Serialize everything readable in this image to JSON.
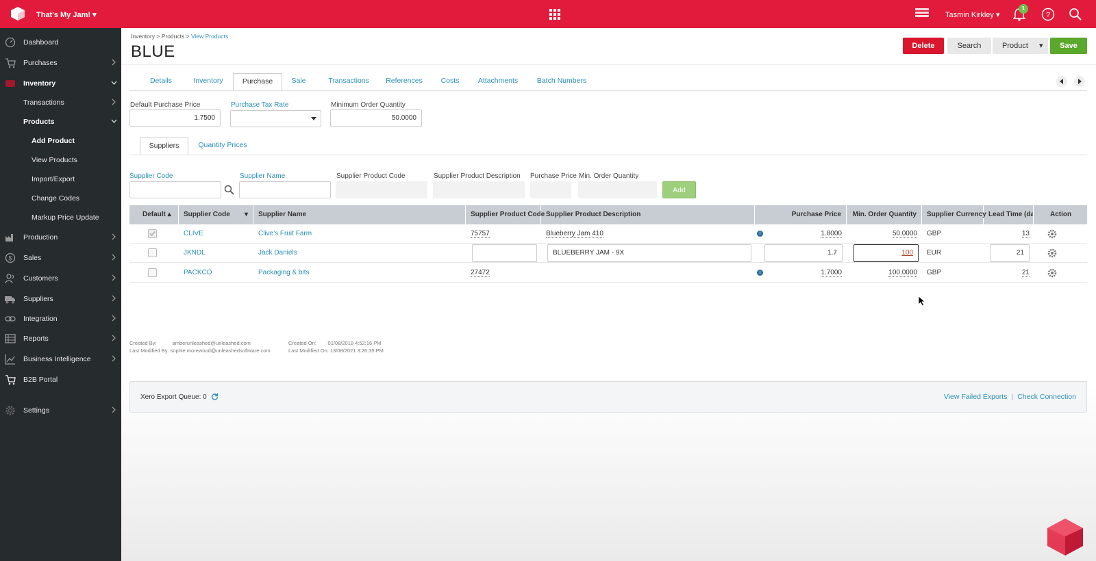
{
  "topbar": {
    "org_name": "That's My Jam!",
    "user_name": "Tasmin Kirkley",
    "notification_count": "1",
    "brand_color": "#e21b3c"
  },
  "sidebar": {
    "items": [
      {
        "label": "Dashboard",
        "icon": "dashboard-icon"
      },
      {
        "label": "Purchases",
        "icon": "cart-icon"
      },
      {
        "label": "Inventory",
        "icon": "inventory-icon"
      },
      {
        "label": "Transactions"
      },
      {
        "label": "Products"
      },
      {
        "label": "Add Product"
      },
      {
        "label": "View Products"
      },
      {
        "label": "Import/Export"
      },
      {
        "label": "Change Codes"
      },
      {
        "label": "Markup Price Update"
      },
      {
        "label": "Production",
        "icon": "factory-icon"
      },
      {
        "label": "Sales",
        "icon": "dollar-icon"
      },
      {
        "label": "Customers",
        "icon": "customers-icon"
      },
      {
        "label": "Suppliers",
        "icon": "truck-icon"
      },
      {
        "label": "Integration",
        "icon": "link-icon"
      },
      {
        "label": "Reports",
        "icon": "reports-icon"
      },
      {
        "label": "Business Intelligence",
        "icon": "chart-icon"
      },
      {
        "label": "B2B Portal",
        "icon": "cart-icon"
      },
      {
        "label": "Settings",
        "icon": "gear-icon"
      }
    ]
  },
  "breadcrumb": {
    "part1": "Inventory",
    "sep": ">",
    "part2": "Products",
    "link": "View Products"
  },
  "page_title": "BLUE",
  "actions": {
    "delete": "Delete",
    "search": "Search",
    "product": "Product",
    "save": "Save"
  },
  "tabs": [
    "Details",
    "Inventory",
    "Purchase",
    "Sale",
    "Transactions",
    "References",
    "Costs",
    "Attachments",
    "Batch Numbers"
  ],
  "active_tab": "Purchase",
  "purchase": {
    "default_price_label": "Default Purchase Price",
    "default_price": "1.7500",
    "tax_rate_label": "Purchase Tax Rate",
    "tax_rate": "",
    "min_order_label": "Minimum Order Quantity",
    "min_order": "50.0000"
  },
  "subtabs": [
    "Suppliers",
    "Quantity Prices"
  ],
  "add_form": {
    "supplier_code": "Supplier Code",
    "supplier_name": "Supplier Name",
    "product_code": "Supplier Product Code",
    "product_desc": "Supplier Product Description",
    "purchase_price": "Purchase Price",
    "min_order": "Min. Order Quantity",
    "add_button": "Add"
  },
  "table": {
    "headers": [
      "Default",
      "Supplier Code",
      "Supplier Name",
      "Supplier Product Code",
      "Supplier Product Description",
      "Purchase Price",
      "Min. Order Quantity",
      "Supplier Currency",
      "Lead Time (day",
      "Action"
    ],
    "rows": [
      {
        "code": "CLIVE",
        "name": "Clive's Fruit Farm",
        "prod_code": "75757",
        "desc": "Blueberry Jam 410",
        "price": "1.8000",
        "min": "50.0000",
        "currency": "GBP",
        "lead": "13"
      },
      {
        "code": "JKNDL",
        "name": "Jack Daniels",
        "prod_code": "",
        "desc": "BLUEBERRY JAM - 9X",
        "price": "1.7",
        "min": "100",
        "currency": "EUR",
        "lead": "21"
      },
      {
        "code": "PACKCO",
        "name": "Packaging & bits",
        "prod_code": "27472",
        "desc": "",
        "price": "1.7000",
        "min": "100.0000",
        "currency": "GBP",
        "lead": "21"
      }
    ]
  },
  "meta": {
    "created_by_label": "Created By:",
    "created_by": "amberunleashed@unleashed.com",
    "created_on_label": "Created On:",
    "created_on": "01/08/2018 4:52:16 PM",
    "modified_by_label": "Last Modified By:",
    "modified_by": "sophie.morewood@unleashedsoftware.com",
    "modified_on_label": "Last Modified On:",
    "modified_on": "13/08/2021 3:26:35 PM"
  },
  "xero": {
    "label": "Xero Export Queue: 0",
    "failed": "View Failed Exports",
    "sep": "|",
    "check": "Check Connection"
  }
}
